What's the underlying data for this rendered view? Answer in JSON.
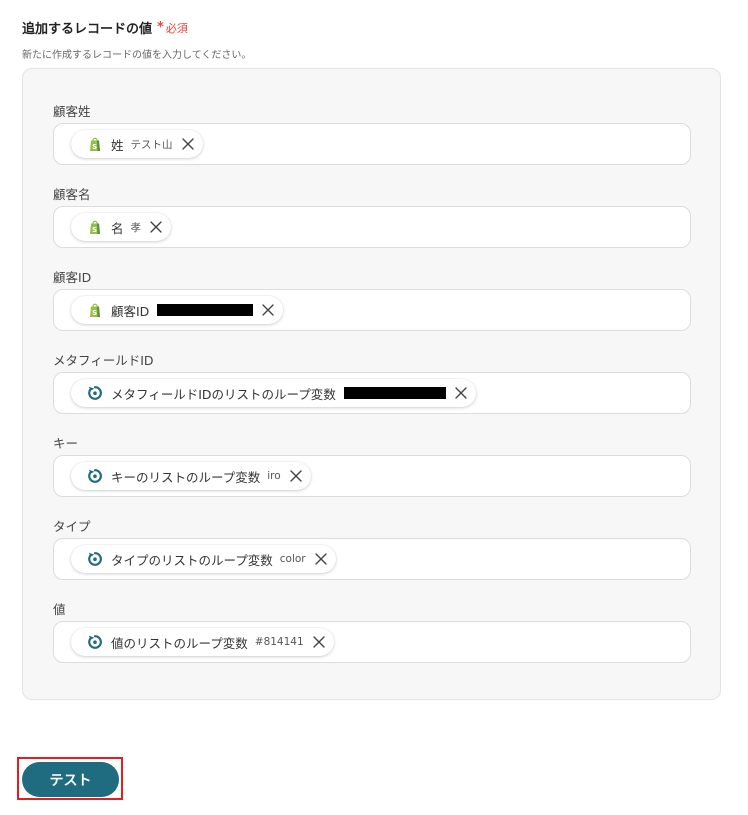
{
  "section": {
    "title": "追加するレコードの値",
    "required_mark": "*",
    "required_text": "必須",
    "description": "新たに作成するレコードの値を入力してください。"
  },
  "fields": [
    {
      "label": "顧客姓",
      "chip_label": "姓",
      "chip_value": "テスト山",
      "icon": "shopify-icon"
    },
    {
      "label": "顧客名",
      "chip_label": "名",
      "chip_value": "孝",
      "icon": "shopify-icon"
    },
    {
      "label": "顧客ID",
      "chip_label": "顧客ID",
      "chip_value": "",
      "icon": "shopify-icon",
      "redacted": true
    },
    {
      "label": "メタフィールドID",
      "chip_label": "メタフィールドIDのリストのループ変数",
      "chip_value": "",
      "icon": "loop-icon",
      "redacted": true
    },
    {
      "label": "キー",
      "chip_label": "キーのリストのループ変数",
      "chip_value": "iro",
      "icon": "loop-icon"
    },
    {
      "label": "タイプ",
      "chip_label": "タイプのリストのループ変数",
      "chip_value": "color",
      "icon": "loop-icon"
    },
    {
      "label": "値",
      "chip_label": "値のリストのループ変数",
      "chip_value": "#814141",
      "icon": "loop-icon"
    }
  ],
  "test_button": {
    "label": "テスト"
  },
  "colors": {
    "accent": "#1f6b80",
    "required": "#e8453c",
    "shopify_green": "#95bf47",
    "loop_teal": "#1f6b80",
    "highlight": "#e02020"
  }
}
